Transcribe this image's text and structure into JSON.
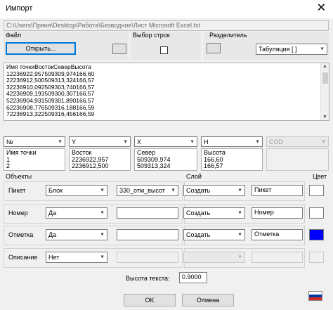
{
  "window": {
    "title": "Импорт",
    "close_glyph": "✕"
  },
  "file_path": "C:\\Users\\Пряня\\Desktop\\Работа\\Безводное\\Лист Microsoft Excel.txt",
  "file_section": {
    "label": "Файл",
    "open_button": "Открыть..."
  },
  "row_select": {
    "label": "Выбор строк"
  },
  "delimiter": {
    "label": "Разделитель",
    "value": "Табуляция  [ ]"
  },
  "preview_lines": [
    "Имя точкиВостокСеверВысота",
    "12236922,957509309,974166,60",
    "22236912,500509313,324166,57",
    "32236910,092509303,740166,57",
    "42236909,193509300,307166,57",
    "52236904,931509301,890166,57",
    "62236908,776509316,188166,59",
    "72236913,322509316,456166,59"
  ],
  "columns": [
    {
      "select": "№",
      "lines": [
        "Имя точки",
        "1",
        "2"
      ],
      "disabled": false
    },
    {
      "select": "Y",
      "lines": [
        "Восток",
        "2236922,957",
        "2236912,500"
      ],
      "disabled": false
    },
    {
      "select": "X",
      "lines": [
        "Север",
        "509309,974",
        "509313,324"
      ],
      "disabled": false
    },
    {
      "select": "H",
      "lines": [
        "Высота",
        "166,60",
        "166,57"
      ],
      "disabled": false
    },
    {
      "select": "COD",
      "lines": [],
      "disabled": true
    }
  ],
  "headers": {
    "objects": "Объекты",
    "layer": "Слой",
    "color": "Цвет"
  },
  "rows": [
    {
      "label": "Пикет",
      "object_type": "Блок",
      "object_value": "330_отм_высот",
      "layer_action": "Создать",
      "layer_name": "Пикет",
      "color": "#ffffff",
      "disabled": false
    },
    {
      "label": "Номер",
      "object_type": "Да",
      "object_value": "",
      "layer_action": "Создать",
      "layer_name": "Номер",
      "color": "#ffffff",
      "disabled": false
    },
    {
      "label": "Отметка",
      "object_type": "Да",
      "object_value": "",
      "layer_action": "Создать",
      "layer_name": "Отметка",
      "color": "#0000ff",
      "disabled": false
    },
    {
      "label": "Описание",
      "object_type": "Нет",
      "object_value": "",
      "layer_action": "",
      "layer_name": "",
      "color": "#f0f0f0",
      "disabled": true
    }
  ],
  "text_height": {
    "label": "Высота текста:",
    "value": "0.9000"
  },
  "buttons": {
    "ok": "OK",
    "cancel": "Отмена"
  },
  "flag_colors": [
    "#ffffff",
    "#0039a6",
    "#d52b1e"
  ]
}
